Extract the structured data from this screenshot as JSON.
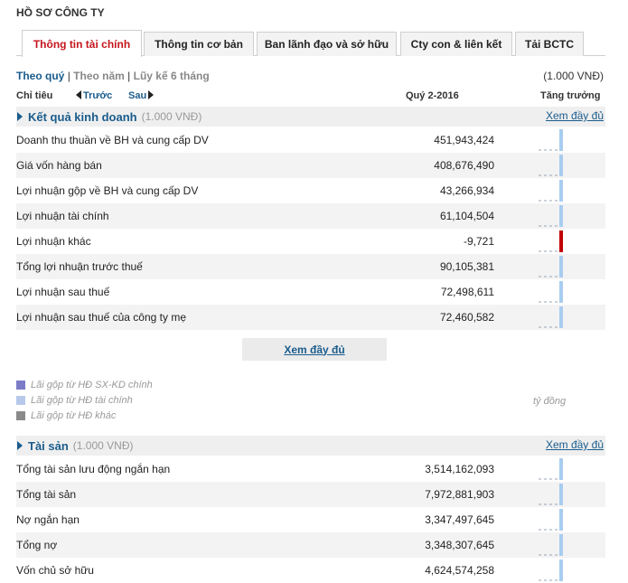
{
  "page": {
    "title": "HỒ SƠ CÔNG TY"
  },
  "tabs": [
    {
      "label": "Thông tin tài chính",
      "active": true
    },
    {
      "label": "Thông tin cơ bản",
      "active": false
    },
    {
      "label": "Ban lãnh đạo và sở hữu",
      "active": false
    },
    {
      "label": "Cty con & liên kết",
      "active": false
    },
    {
      "label": "Tải BCTC",
      "active": false
    }
  ],
  "period": {
    "quarter": "Theo quý",
    "sep1": "|",
    "year": "Theo năm",
    "sep2": "|",
    "cumulative": "Lũy kế 6 tháng",
    "unit": "(1.000 VNĐ)"
  },
  "columns": {
    "indicator": "Chỉ tiêu",
    "prev": "Trước",
    "next": "Sau",
    "period": "Quý 2-2016",
    "growth": "Tăng trưởng"
  },
  "income": {
    "title": "Kết quả kinh doanh",
    "unit": "(1.000 VNĐ)",
    "more": "Xem đầy đủ",
    "rows": [
      {
        "label": "Doanh thu thuần về BH và cung cấp DV",
        "value": "451,943,424",
        "positive": true
      },
      {
        "label": "Giá vốn hàng bán",
        "value": "408,676,490",
        "positive": true
      },
      {
        "label": "Lợi nhuận gộp về BH và cung cấp DV",
        "value": "43,266,934",
        "positive": true
      },
      {
        "label": "Lợi nhuận tài chính",
        "value": "61,104,504",
        "positive": true
      },
      {
        "label": "Lợi nhuận khác",
        "value": "-9,721",
        "positive": false
      },
      {
        "label": "Tổng lợi nhuận trước thuế",
        "value": "90,105,381",
        "positive": true
      },
      {
        "label": "Lợi nhuận sau thuế",
        "value": "72,498,611",
        "positive": true
      },
      {
        "label": "Lợi nhuận sau thuế của công ty mẹ",
        "value": "72,460,582",
        "positive": true
      }
    ],
    "more_button": "Xem đầy đủ"
  },
  "legend": {
    "items": [
      {
        "label": "Lãi gộp từ HĐ SX-KD chính",
        "color": "#7b7bc8"
      },
      {
        "label": "Lãi gộp từ HĐ tài chính",
        "color": "#b8c8ea"
      },
      {
        "label": "Lãi gộp từ HĐ khác",
        "color": "#8a8a8a"
      }
    ],
    "unit": "tỷ đồng"
  },
  "assets": {
    "title": "Tài sản",
    "unit": "(1.000 VNĐ)",
    "more": "Xem đầy đủ",
    "rows": [
      {
        "label": "Tổng tài sản lưu động ngắn hạn",
        "value": "3,514,162,093",
        "positive": true
      },
      {
        "label": "Tổng tài sản",
        "value": "7,972,881,903",
        "positive": true
      },
      {
        "label": "Nợ ngắn hạn",
        "value": "3,347,497,645",
        "positive": true
      },
      {
        "label": "Tổng nợ",
        "value": "3,348,307,645",
        "positive": true
      },
      {
        "label": "Vốn chủ sở hữu",
        "value": "4,624,574,258",
        "positive": true
      }
    ]
  },
  "colors": {
    "accent": "#1a5c8c",
    "active_tab": "#c4161c",
    "bar_positive": "#a8cdf0",
    "bar_negative": "#c00000",
    "row_alt": "#f3f3f3"
  }
}
